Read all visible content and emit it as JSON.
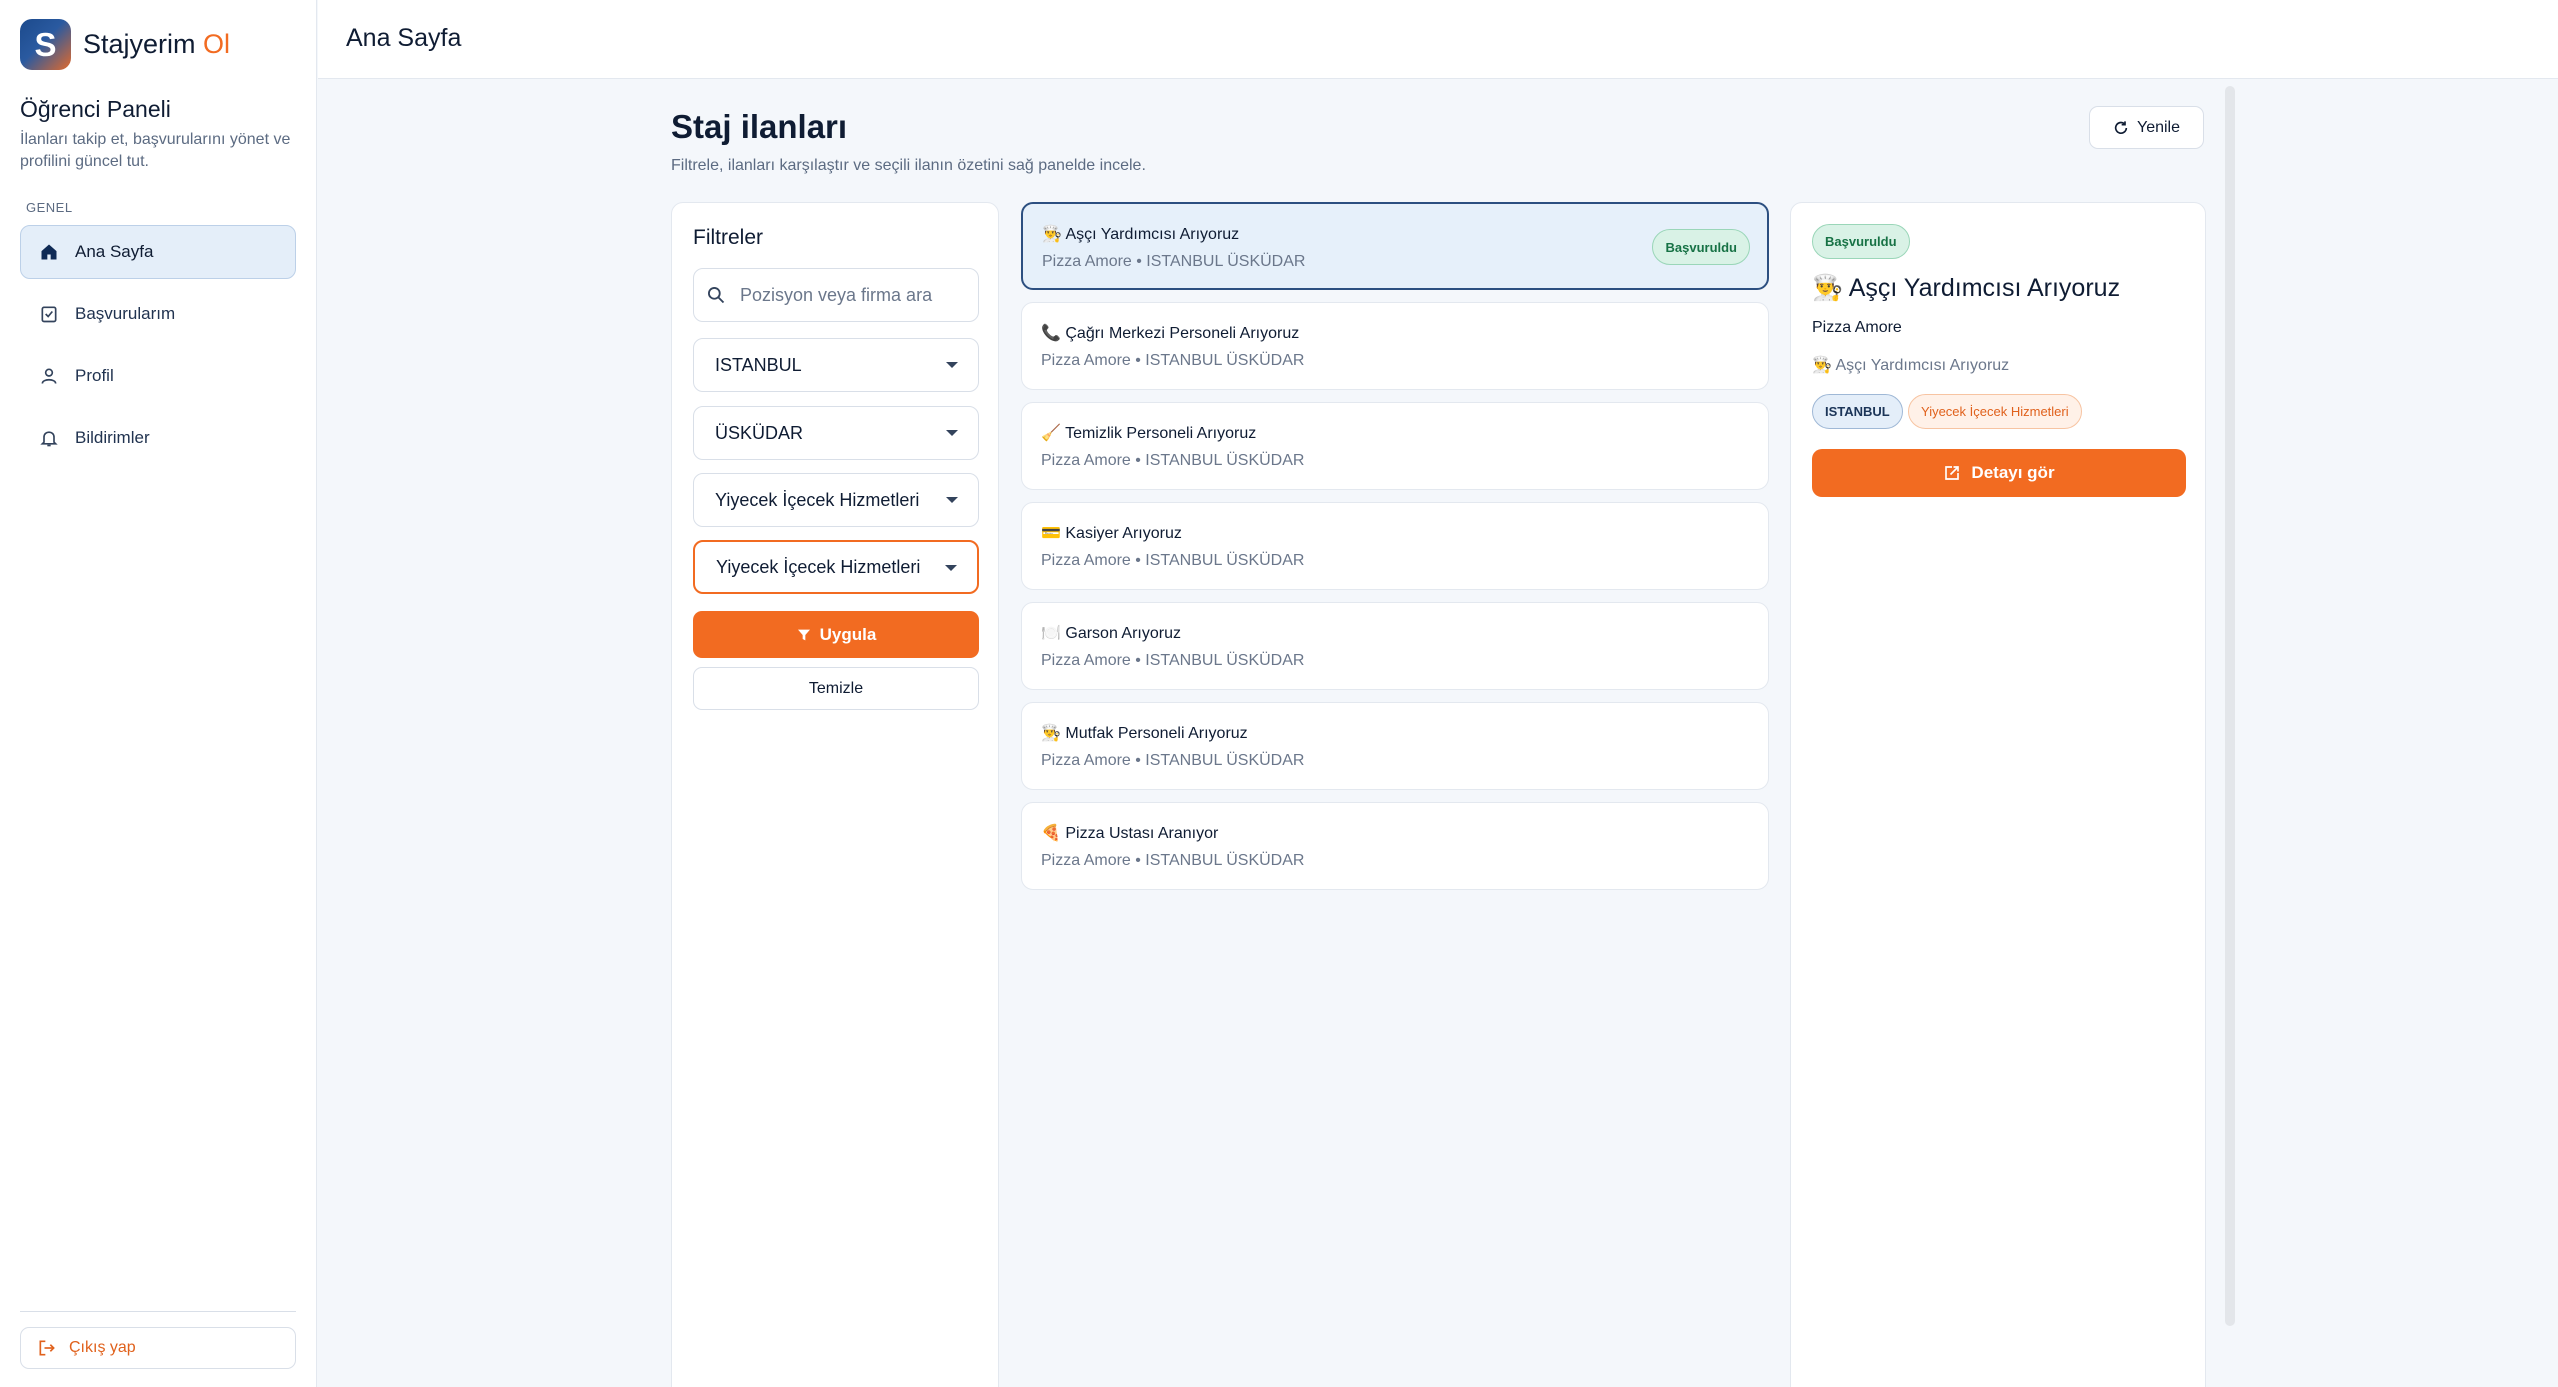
{
  "brand": {
    "logo_letter": "S",
    "name": "Stajyerim",
    "accent": "Ol",
    "accent_color": "#f26b21"
  },
  "sidebar": {
    "panel_title": "Öğrenci Paneli",
    "panel_desc": "İlanları takip et, başvurularını yönet ve profilini güncel tut.",
    "section_label": "GENEL",
    "items": [
      {
        "label": "Ana Sayfa",
        "icon": "home-icon",
        "active": true
      },
      {
        "label": "Başvurularım",
        "icon": "clipboard-check-icon"
      },
      {
        "label": "Profil",
        "icon": "user-icon"
      },
      {
        "label": "Bildirimler",
        "icon": "bell-icon"
      }
    ],
    "logout_label": "Çıkış yap"
  },
  "topbar": {
    "title": "Ana Sayfa"
  },
  "main": {
    "title": "Staj ilanları",
    "subtitle": "Filtrele, ilanları karşılaştır ve seçili ilanın özetini sağ panelde incele.",
    "refresh_label": "Yenile"
  },
  "filters": {
    "title": "Filtreler",
    "search_placeholder": "Pozisyon veya firma ara",
    "city": "ISTANBUL",
    "district": "ÜSKÜDAR",
    "sector": "Yiyecek İçecek Hizmetleri",
    "subsector": "Yiyecek İçecek Hizmetleri",
    "apply_label": "Uygula",
    "clear_label": "Temizle"
  },
  "listings": [
    {
      "title": "👨‍🍳 Aşçı Yardımcısı Arıyoruz",
      "subtitle": "Pizza Amore • ISTANBUL ÜSKÜDAR",
      "badge": "Başvuruldu",
      "selected": true
    },
    {
      "title": "📞 Çağrı Merkezi Personeli Arıyoruz",
      "subtitle": "Pizza Amore • ISTANBUL ÜSKÜDAR"
    },
    {
      "title": "🧹 Temizlik Personeli Arıyoruz",
      "subtitle": "Pizza Amore • ISTANBUL ÜSKÜDAR"
    },
    {
      "title": "💳 Kasiyer Arıyoruz",
      "subtitle": "Pizza Amore • ISTANBUL ÜSKÜDAR"
    },
    {
      "title": "🍽️ Garson Arıyoruz",
      "subtitle": "Pizza Amore • ISTANBUL ÜSKÜDAR"
    },
    {
      "title": "👨‍🍳 Mutfak Personeli Arıyoruz",
      "subtitle": "Pizza Amore • ISTANBUL ÜSKÜDAR"
    },
    {
      "title": "🍕 Pizza Ustası Aranıyor",
      "subtitle": "Pizza Amore • ISTANBUL ÜSKÜDAR"
    }
  ],
  "detail": {
    "badge": "Başvuruldu",
    "title": "👨‍🍳 Aşçı Yardımcısı Arıyoruz",
    "company": "Pizza Amore",
    "position": "👨‍🍳 Aşçı Yardımcısı Arıyoruz",
    "city_tag": "ISTANBUL",
    "sector_tag": "Yiyecek İçecek Hizmetleri",
    "button_label": "Detayı gör"
  }
}
